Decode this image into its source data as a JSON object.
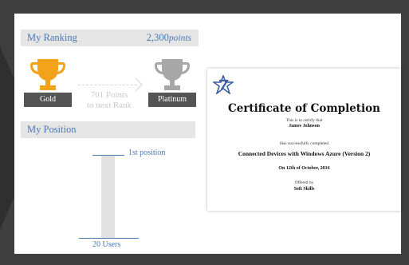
{
  "ranking": {
    "title": "My Ranking",
    "points_value": "2,300",
    "points_unit": "points",
    "current_rank": "Gold",
    "next_rank": "Platinum",
    "points_to_next_line1": "701 Points",
    "points_to_next_line2": "to next Rank",
    "colors": {
      "gold": "#f2a31a",
      "platinum": "#a7a7a7",
      "accent": "#4a78b0"
    }
  },
  "position": {
    "title": "My Position",
    "position_label": "1st position",
    "users_label": "20 Users"
  },
  "certificate": {
    "title": "Certificate of Completion",
    "certify_text": "This is to certify that",
    "name": "James Johnson",
    "completed_text": "Has successfully completed",
    "course": "Connected Devices with Windows Azure (Version 2)",
    "date_text": "On 12th of October, 2016",
    "offered_by_text": "Offered by",
    "offered_by": "Soft Skills",
    "logo_icon": "star-logo-icon"
  }
}
